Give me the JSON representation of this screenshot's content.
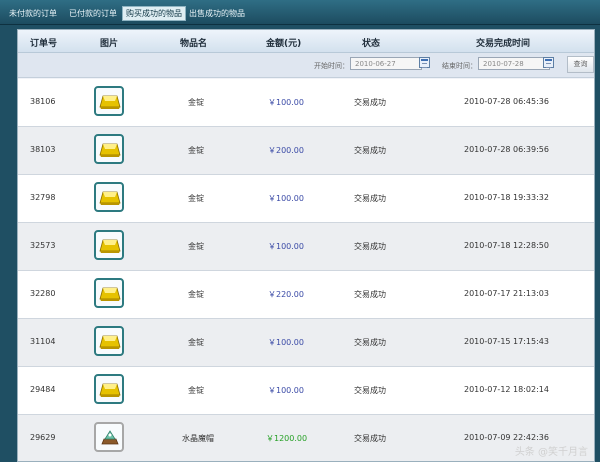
{
  "tabs": [
    {
      "label": "未付款的订单"
    },
    {
      "label": "已付款的订单"
    },
    {
      "label": "购买成功的物品"
    },
    {
      "label": "出售成功的物品"
    }
  ],
  "table": {
    "headers": [
      "订单号",
      "图片",
      "物品名",
      "金额(元)",
      "状态",
      "交易完成时间"
    ]
  },
  "filter": {
    "start_label": "开始时间：",
    "start_value": "2010-06-27",
    "end_label": "结束时间：",
    "end_value": "2010-07-28",
    "search_label": "查询"
  },
  "rows": [
    {
      "id": "38106",
      "name": "金锭",
      "amount": "￥100.00",
      "status": "交易成功",
      "time": "2010-07-28 06:45:36",
      "image": "gold-ingot-icon"
    },
    {
      "id": "38103",
      "name": "金锭",
      "amount": "￥200.00",
      "status": "交易成功",
      "time": "2010-07-28 06:39:56",
      "image": "gold-ingot-icon"
    },
    {
      "id": "32798",
      "name": "金锭",
      "amount": "￥100.00",
      "status": "交易成功",
      "time": "2010-07-18 19:33:32",
      "image": "gold-ingot-icon"
    },
    {
      "id": "32573",
      "name": "金锭",
      "amount": "￥100.00",
      "status": "交易成功",
      "time": "2010-07-18 12:28:50",
      "image": "gold-ingot-icon"
    },
    {
      "id": "32280",
      "name": "金锭",
      "amount": "￥220.00",
      "status": "交易成功",
      "time": "2010-07-17 21:13:03",
      "image": "gold-ingot-icon"
    },
    {
      "id": "31104",
      "name": "金锭",
      "amount": "￥100.00",
      "status": "交易成功",
      "time": "2010-07-15 17:15:43",
      "image": "gold-ingot-icon"
    },
    {
      "id": "29484",
      "name": "金锭",
      "amount": "￥100.00",
      "status": "交易成功",
      "time": "2010-07-12 18:02:14",
      "image": "gold-ingot-icon"
    },
    {
      "id": "29629",
      "name": "水晶魔帽",
      "amount": "￥1200.00",
      "status": "交易成功",
      "time": "2010-07-09 22:42:36",
      "image": "crystal-hat-icon"
    }
  ],
  "watermark": "头条 @笑千月言",
  "colors": {
    "tab_bar": "#1f4f63",
    "amount": "#3a4aa6",
    "amount_highlight": "#26a026",
    "thumb_border": "#2d7a80"
  }
}
